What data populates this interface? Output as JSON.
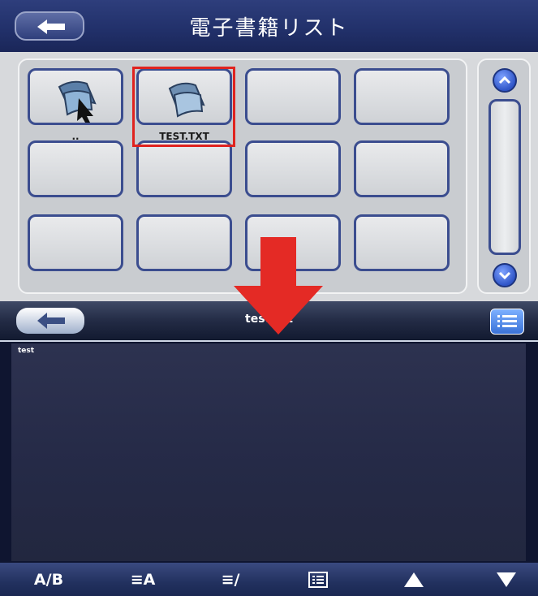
{
  "top": {
    "title": "電子書籍リスト",
    "grid": {
      "items": [
        {
          "label": "..",
          "kind": "parent-folder"
        },
        {
          "label": "TEST.TXT",
          "kind": "file",
          "selected": true
        }
      ]
    }
  },
  "bottom": {
    "title": "test.txt",
    "content": "test",
    "toolbar": {
      "ab_label": "A/B",
      "font_label": "≡A",
      "style_label": "≡/",
      "list_icon": "list-icon",
      "up_icon": "up-triangle-icon",
      "down_icon": "down-triangle-icon"
    }
  },
  "colors": {
    "header_blue": "#22316b",
    "tile_border": "#3b4d8f",
    "selection": "#e0231f",
    "text_bg": "#2a2f4c",
    "arrow": "#e42a25"
  }
}
